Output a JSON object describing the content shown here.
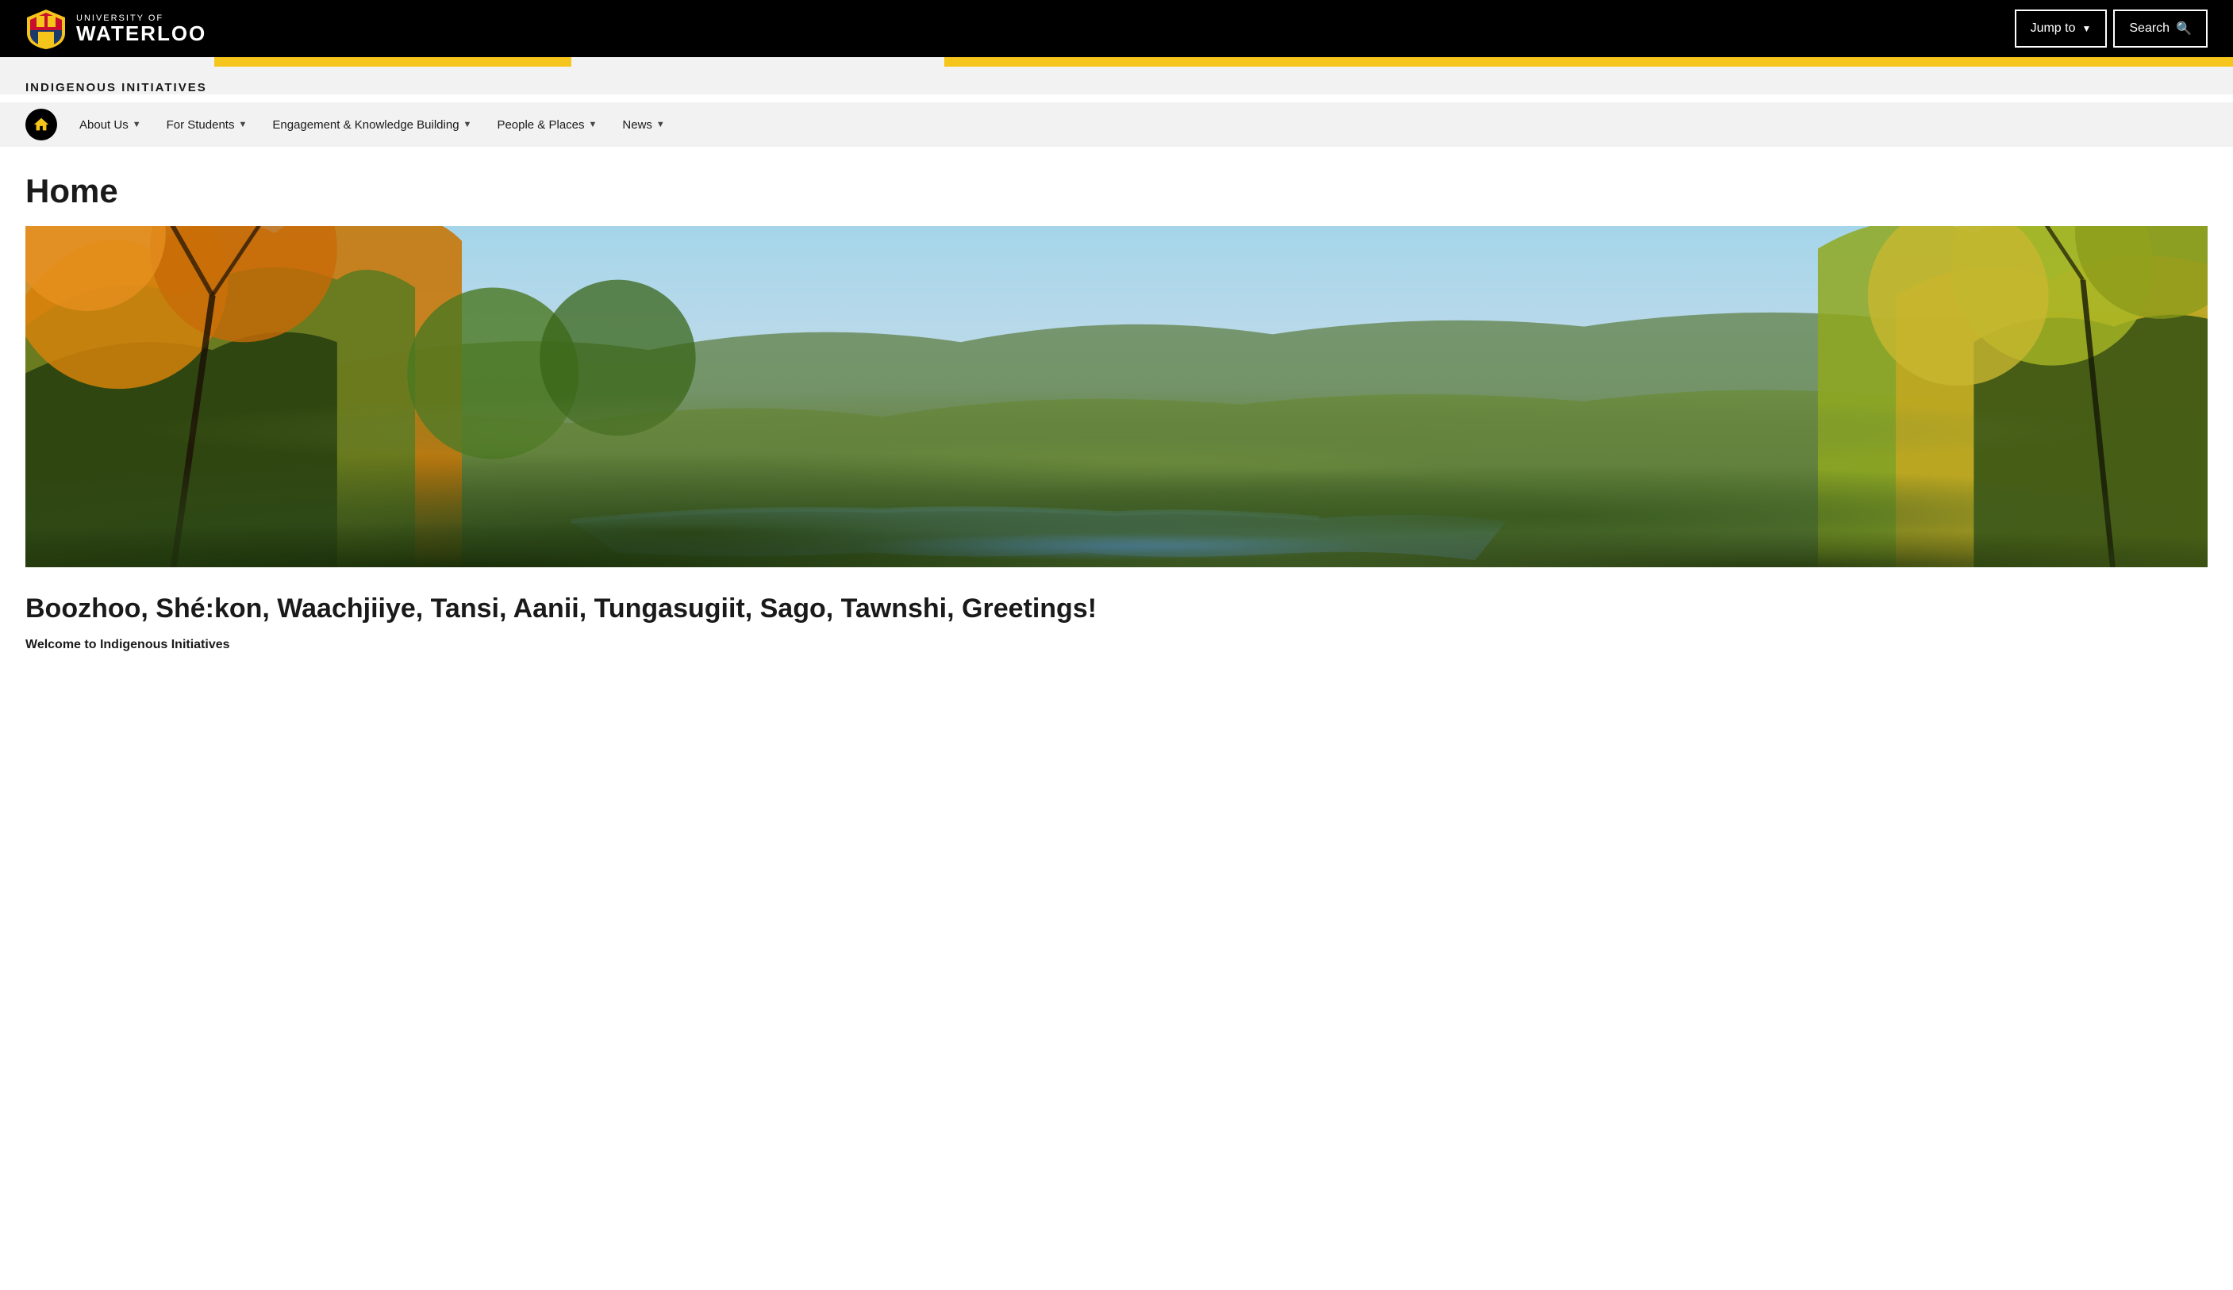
{
  "header": {
    "logo": {
      "university_of": "UNIVERSITY OF",
      "waterloo": "WATERLOO"
    },
    "jump_to_label": "Jump to",
    "search_label": "Search"
  },
  "color_bar": {
    "segments": [
      "light",
      "gold",
      "light",
      "gold"
    ]
  },
  "section": {
    "title": "INDIGENOUS INITIATIVES"
  },
  "nav": {
    "home_label": "Home",
    "items": [
      {
        "label": "About Us",
        "has_dropdown": true
      },
      {
        "label": "For Students",
        "has_dropdown": true
      },
      {
        "label": "Engagement & Knowledge Building",
        "has_dropdown": true
      },
      {
        "label": "People & Places",
        "has_dropdown": true
      },
      {
        "label": "News",
        "has_dropdown": true
      }
    ]
  },
  "page": {
    "title": "Home",
    "hero_alt": "Scenic autumn forest landscape with river valley",
    "greeting": "Boozhoo, Shé:kon, Waachjiiye, Tansi, Aanii, Tungasugiit, Sago, Tawnshi, Greetings!",
    "welcome": "Welcome to Indigenous Initiatives"
  }
}
